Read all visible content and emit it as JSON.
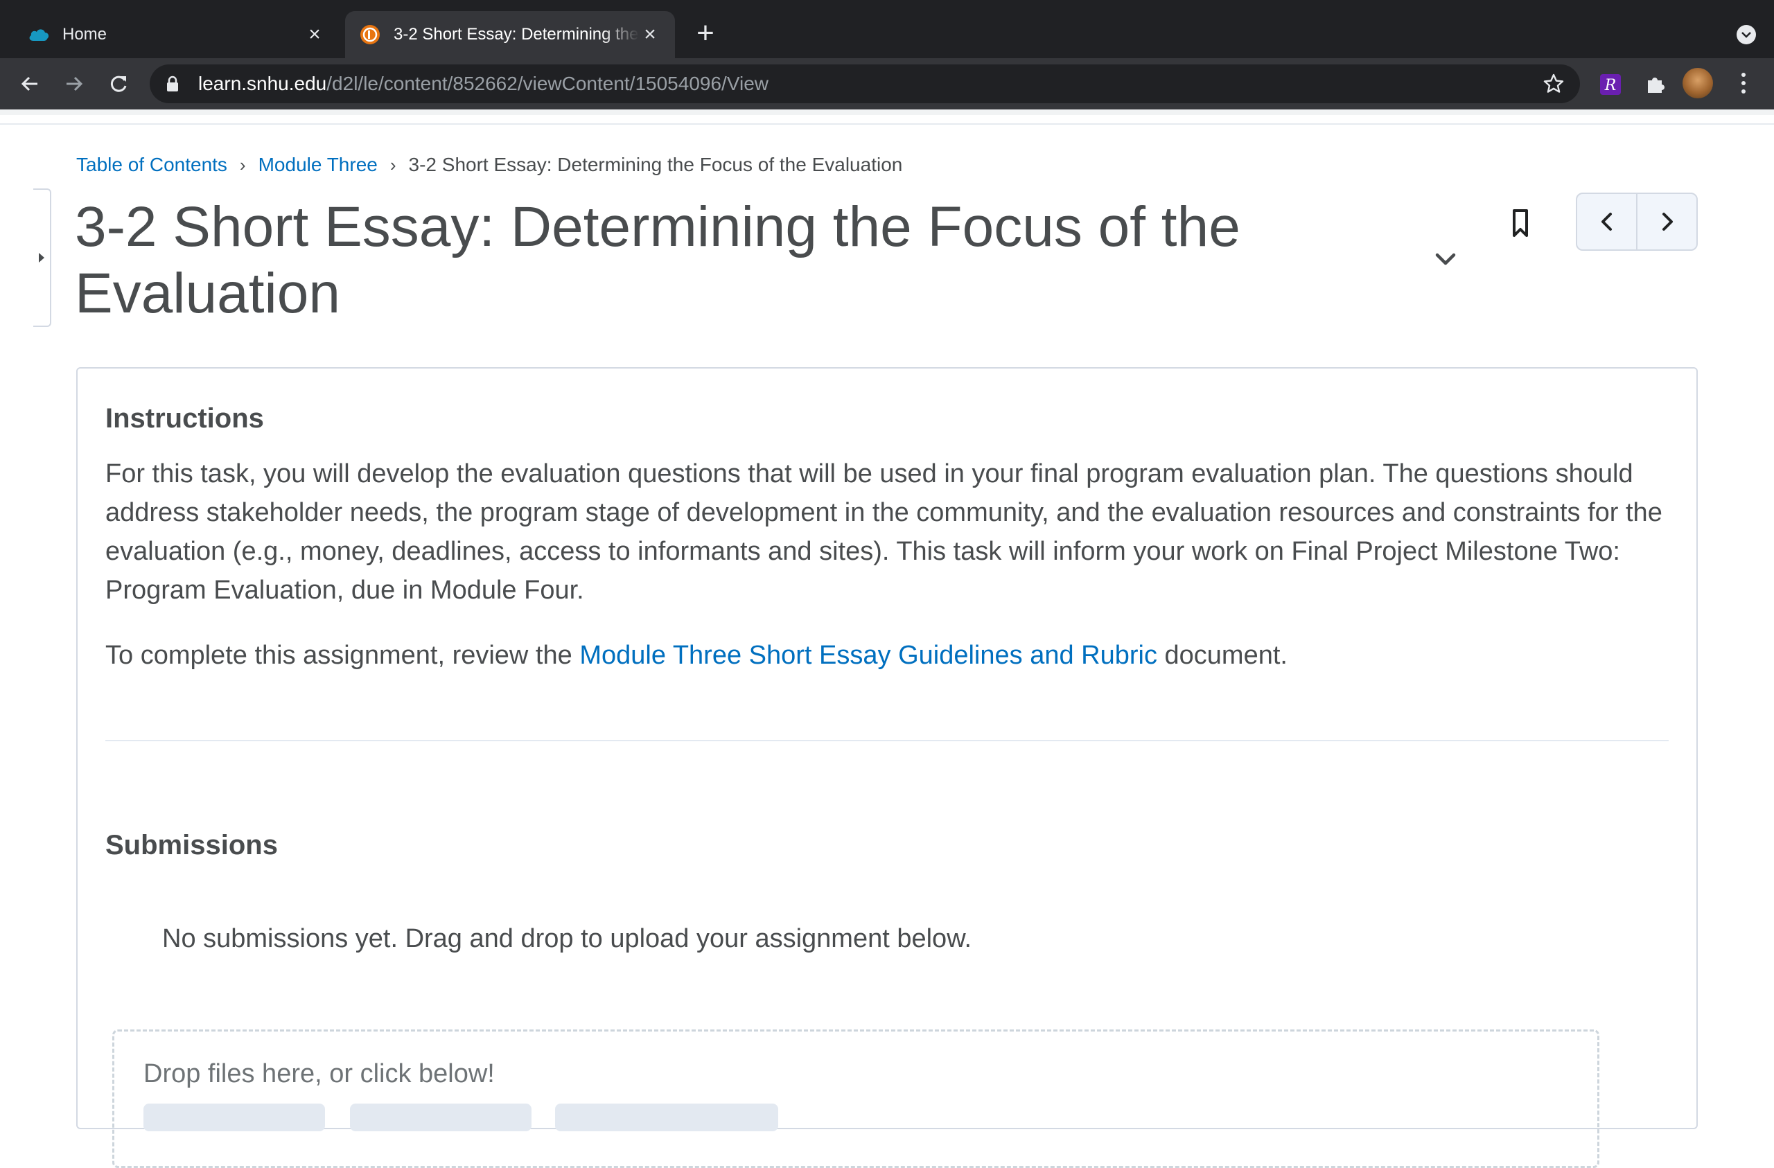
{
  "browser": {
    "tabs": [
      {
        "title": "Home",
        "active": false
      },
      {
        "title": "3-2 Short Essay: Determining the Focus of the Evaluation",
        "active": true
      }
    ],
    "url_host": "learn.snhu.edu",
    "url_path": "/d2l/le/content/852662/viewContent/15054096/View",
    "icons": [
      "back-icon",
      "forward-icon",
      "reload-icon",
      "lock-icon",
      "star-icon",
      "extension-icon",
      "puzzle-icon",
      "profile-avatar",
      "kebab-menu-icon"
    ]
  },
  "breadcrumb": {
    "items": [
      "Table of Contents",
      "Module Three"
    ],
    "current": "3-2 Short Essay: Determining the Focus of the Evaluation"
  },
  "page": {
    "title": "3-2 Short Essay: Determining the Focus of the Evaluation"
  },
  "instructions": {
    "heading": "Instructions",
    "paragraph1": "For this task, you will develop the evaluation questions that will be used in your final program evaluation plan. The questions should address stakeholder needs, the program stage of development in the community, and the evaluation resources and constraints for the evaluation (e.g., money, deadlines, access to informants and sites). This task will inform your work on Final Project Milestone Two: Program Evaluation, due in Module Four.",
    "paragraph2_prefix": "To complete this assignment, review the ",
    "paragraph2_link": "Module Three Short Essay Guidelines and Rubric",
    "paragraph2_suffix": " document."
  },
  "submissions": {
    "heading": "Submissions",
    "empty_text": "No submissions yet. Drag and drop to upload your assignment below.",
    "dropzone_text": "Drop files here, or click below!"
  },
  "colors": {
    "chrome_dark": "#202124",
    "chrome_toolbar": "#35363a",
    "link": "#006fbf",
    "text": "#494c4e",
    "border": "#d3d9e3"
  }
}
